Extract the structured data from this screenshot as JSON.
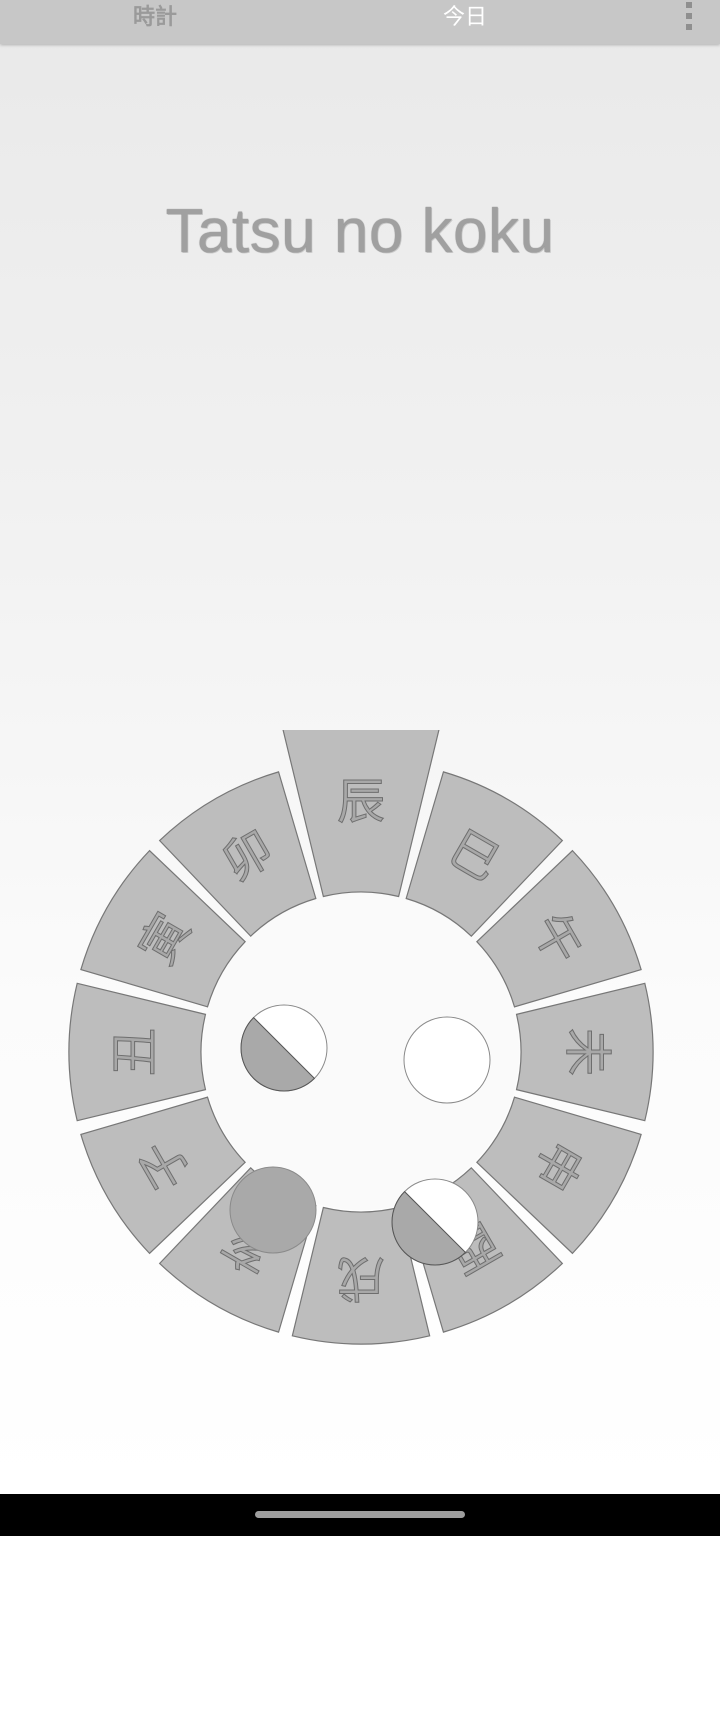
{
  "toolbar": {
    "tab_clock": "時計",
    "tab_today": "今日",
    "menu_icon": "overflow-menu-icon"
  },
  "main": {
    "title": "Tatsu no koku"
  },
  "wheel": {
    "current_index": 4,
    "segments": [
      "子",
      "丑",
      "寅",
      "卯",
      "辰",
      "巳",
      "午",
      "未",
      "申",
      "酉",
      "戌",
      "亥"
    ],
    "colors": {
      "segment_fill": "#bdbdbd",
      "segment_stroke": "#777777",
      "label_fill": "#a8a8a8",
      "label_stroke": "#6e6e6e",
      "inner_fill": "#fafafa",
      "moon_dark": "#a9a9a9",
      "moon_light": "#ffffff"
    },
    "moon_phases": [
      "waxing-half",
      "new",
      "full",
      "waning-half"
    ]
  }
}
